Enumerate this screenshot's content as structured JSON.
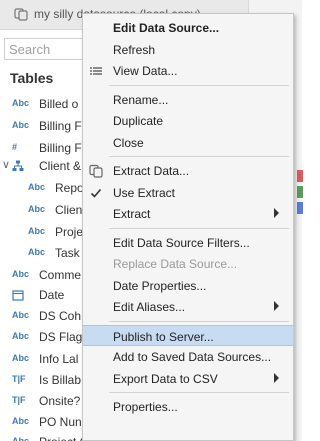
{
  "datasource": {
    "name": "my silly datasource (local copy)",
    "icon": "datasource-icon"
  },
  "search": {
    "placeholder": "Search"
  },
  "tables": {
    "title": "Tables",
    "fields": [
      {
        "type": "Abc",
        "label": "Billed o"
      },
      {
        "type": "Abc",
        "label": "Billing F"
      },
      {
        "type": "#",
        "label": "Billing F"
      },
      {
        "type": "hier",
        "label": "Client &",
        "icon": "hierarchy-icon",
        "expanded": true
      },
      {
        "type": "Abc",
        "label": "Repo",
        "indent": true
      },
      {
        "type": "Abc",
        "label": "Clien",
        "indent": true
      },
      {
        "type": "Abc",
        "label": "Proje",
        "indent": true
      },
      {
        "type": "Abc",
        "label": "Task",
        "indent": true
      },
      {
        "type": "Abc",
        "label": "Comme"
      },
      {
        "type": "date",
        "label": "Date",
        "icon": "calendar-icon"
      },
      {
        "type": "Abc",
        "label": "DS Coh"
      },
      {
        "type": "Abc",
        "label": "DS Flag"
      },
      {
        "type": "Abc",
        "label": "Info Lal"
      },
      {
        "type": "T|F",
        "label": "Is Billab"
      },
      {
        "type": "T|F",
        "label": "Onsite?"
      },
      {
        "type": "Abc",
        "label": "PO Nun"
      },
      {
        "type": "Abc",
        "label": "Project Currency"
      }
    ]
  },
  "menu": {
    "items": [
      {
        "label": "Edit Data Source...",
        "bold": true
      },
      {
        "label": "Refresh"
      },
      {
        "label": "View Data...",
        "icon": "view-data-icon"
      },
      {
        "sep": true
      },
      {
        "label": "Rename..."
      },
      {
        "label": "Duplicate"
      },
      {
        "label": "Close"
      },
      {
        "sep": true
      },
      {
        "label": "Extract Data...",
        "icon": "extract-icon"
      },
      {
        "label": "Use Extract",
        "icon": "checkmark-icon"
      },
      {
        "label": "Extract",
        "submenu": true
      },
      {
        "sep": true
      },
      {
        "label": "Edit Data Source Filters..."
      },
      {
        "label": "Replace Data Source...",
        "disabled": true
      },
      {
        "label": "Date Properties..."
      },
      {
        "label": "Edit Aliases...",
        "submenu": true
      },
      {
        "sep": true
      },
      {
        "label": "Publish to Server...",
        "highlighted": true
      },
      {
        "label": "Add to Saved Data Sources..."
      },
      {
        "label": "Export Data to CSV",
        "submenu": true
      },
      {
        "sep": true
      },
      {
        "label": "Properties..."
      }
    ]
  },
  "colors": {
    "highlight": "#c7dcf2",
    "type_blue": "#3a7ab8",
    "menu_bg": "#f5f5f5"
  }
}
